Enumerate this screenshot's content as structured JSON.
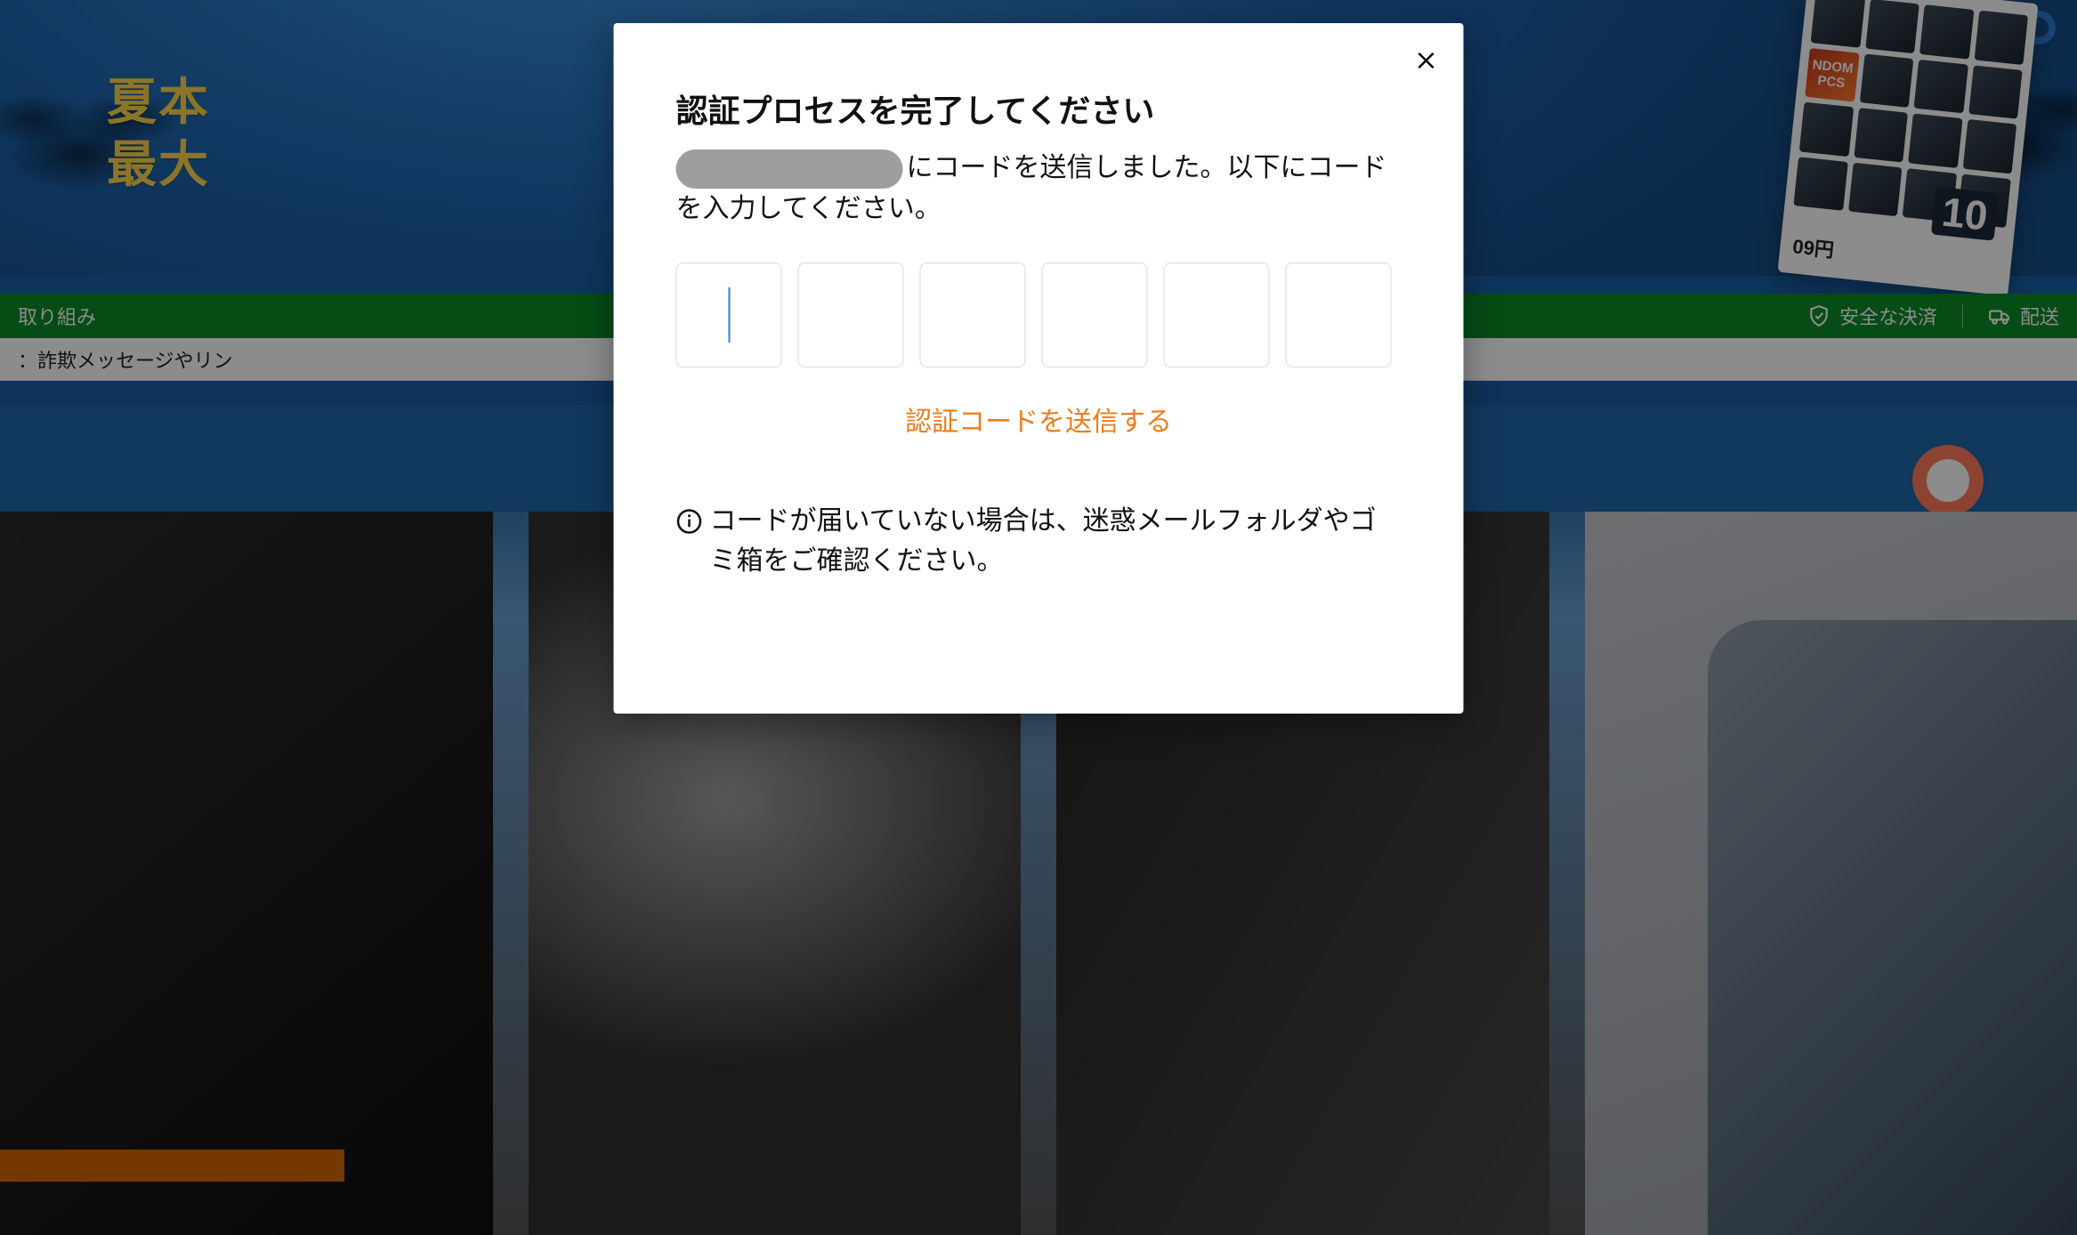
{
  "background": {
    "headline1": "夏本",
    "headline2": "最大",
    "greenbar": {
      "left_text": "取り組み",
      "right1": "安全な決済",
      "right2": "配送"
    },
    "whitebar_text": "：詐欺メッセージやリン",
    "card": {
      "tag": "NDOM\nPCS",
      "big": "10",
      "price": "09円"
    }
  },
  "modal": {
    "title": "認証プロセスを完了してください",
    "desc_after": "にコードを送信しました。以下にコードを入力してください。",
    "resend": "認証コードを送信する",
    "note": "コードが届いていない場合は、迷惑メールフォルダやゴミ箱をご確認ください。",
    "close_aria": "閉じる",
    "code_len": 6
  }
}
